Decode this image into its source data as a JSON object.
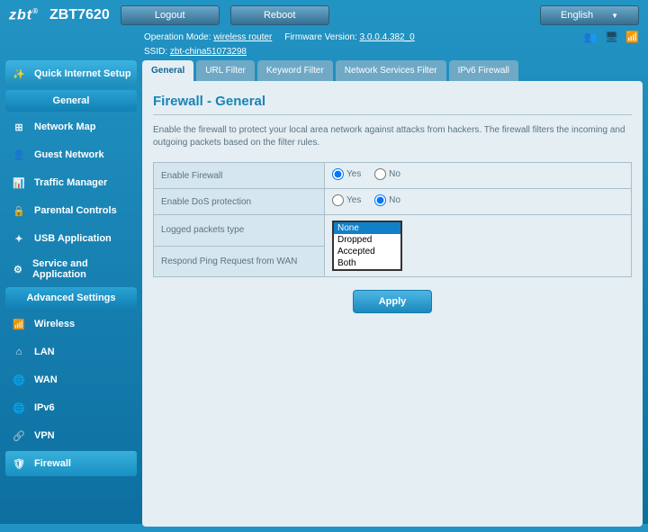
{
  "brand": "zbt",
  "model": "ZBT7620",
  "header": {
    "logout": "Logout",
    "reboot": "Reboot",
    "language": "English"
  },
  "info": {
    "op_mode_label": "Operation Mode:",
    "op_mode": "wireless router",
    "fw_label": "Firmware Version:",
    "fw": "3.0.0.4.382_0",
    "ssid_label": "SSID:",
    "ssid": "zbt-china51073298"
  },
  "sidebar": {
    "quick": "Quick Internet Setup",
    "general_header": "General",
    "general_items": [
      "Network Map",
      "Guest Network",
      "Traffic Manager",
      "Parental Controls",
      "USB Application",
      "Service and Application"
    ],
    "advanced_header": "Advanced Settings",
    "advanced_items": [
      "Wireless",
      "LAN",
      "WAN",
      "IPv6",
      "VPN",
      "Firewall"
    ]
  },
  "tabs": [
    "General",
    "URL Filter",
    "Keyword Filter",
    "Network Services Filter",
    "IPv6 Firewall"
  ],
  "panel": {
    "title": "Firewall - General",
    "desc": "Enable the firewall to protect your local area network against attacks from hackers. The firewall filters the incoming and outgoing packets based on the filter rules.",
    "rows": {
      "enable_fw": "Enable Firewall",
      "enable_dos": "Enable DoS protection",
      "logged": "Logged packets type",
      "ping": "Respond Ping Request from WAN"
    },
    "yes": "Yes",
    "no": "No",
    "dropdown_opts": [
      "None",
      "Dropped",
      "Accepted",
      "Both"
    ],
    "apply": "Apply"
  }
}
